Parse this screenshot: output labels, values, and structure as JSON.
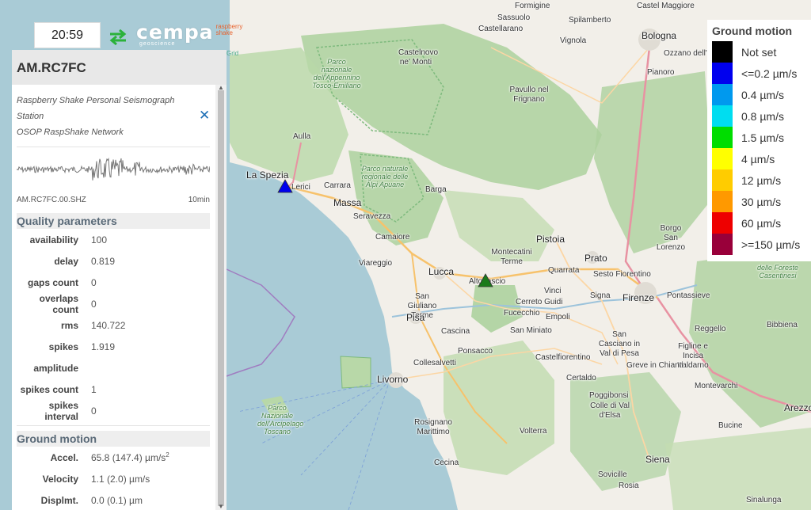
{
  "topbar": {
    "clock": "20:59",
    "logo_main": "cempa",
    "logo_sub": "geoscience",
    "logo_tag_1": "raspberry",
    "logo_tag_2": "shake"
  },
  "panel": {
    "station_code": "AM.RC7FC",
    "description_1": "Raspberry Shake Personal Seismograph Station",
    "description_2": "OSOP RaspShake Network",
    "waveform_channel": "AM.RC7FC.00.SHZ",
    "waveform_span": "10min",
    "quality_title": "Quality parameters",
    "quality": [
      {
        "key": "availability",
        "value": "100"
      },
      {
        "key": "delay",
        "value": "0.819"
      },
      {
        "key": "gaps count",
        "value": "0"
      },
      {
        "key": "overlaps count",
        "value": "0"
      },
      {
        "key": "rms",
        "value": "140.722"
      },
      {
        "key": "spikes",
        "value": "1.919"
      },
      {
        "key": "amplitude",
        "value": ""
      },
      {
        "key": "spikes count",
        "value": "1"
      },
      {
        "key": "spikes interval",
        "value": "0"
      }
    ],
    "motion_title": "Ground motion",
    "motion": [
      {
        "key": "Accel.",
        "value": "65.8 (147.4) µm/s",
        "sup": "2"
      },
      {
        "key": "Velocity",
        "value": "1.1 (2.0) µm/s",
        "sup": ""
      },
      {
        "key": "Displmt.",
        "value": "0.0 (0.1) µm",
        "sup": ""
      }
    ]
  },
  "legend": {
    "title": "Ground motion",
    "items": [
      {
        "label": "Not set",
        "color": "#000000"
      },
      {
        "label": "<=0.2 µm/s",
        "color": "#0000ee"
      },
      {
        "label": "0.4 µm/s",
        "color": "#0099ee"
      },
      {
        "label": "0.8 µm/s",
        "color": "#00ddf0"
      },
      {
        "label": "1.5 µm/s",
        "color": "#00dd00"
      },
      {
        "label": "4 µm/s",
        "color": "#ffff00"
      },
      {
        "label": "12 µm/s",
        "color": "#ffcc00"
      },
      {
        "label": "30 µm/s",
        "color": "#ff9900"
      },
      {
        "label": "60 µm/s",
        "color": "#ee0000"
      },
      {
        "label": ">=150 µm/s",
        "color": "#99003a"
      }
    ]
  },
  "map": {
    "attribution": "Grid",
    "places": [
      {
        "id": "formigine",
        "name": "Formigine"
      },
      {
        "id": "sassuolo",
        "name": "Sassuolo"
      },
      {
        "id": "spilamberto",
        "name": "Spilamberto"
      },
      {
        "id": "castelmaggiore",
        "name": "Castel Maggiore"
      },
      {
        "id": "castellarano",
        "name": "Castellarano"
      },
      {
        "id": "vignola",
        "name": "Vignola"
      },
      {
        "id": "bologna",
        "name": "Bologna"
      },
      {
        "id": "ozzano",
        "name": "Ozzano dell'E"
      },
      {
        "id": "castelnovo",
        "name": "Castelnovo ne' Monti"
      },
      {
        "id": "pianoro",
        "name": "Pianoro"
      },
      {
        "id": "pavullo",
        "name": "Pavullo nel Frignano"
      },
      {
        "id": "aulla",
        "name": "Aulla"
      },
      {
        "id": "laspezia",
        "name": "La Spezia"
      },
      {
        "id": "lerici",
        "name": "Lerici"
      },
      {
        "id": "carrara",
        "name": "Carrara"
      },
      {
        "id": "massa",
        "name": "Massa"
      },
      {
        "id": "seravezza",
        "name": "Seravezza"
      },
      {
        "id": "barga",
        "name": "Barga"
      },
      {
        "id": "camaiore",
        "name": "Camaiore"
      },
      {
        "id": "viareggio",
        "name": "Viareggio"
      },
      {
        "id": "pistoia",
        "name": "Pistoia"
      },
      {
        "id": "borgosansenzo",
        "name": "Borgo San Lorenzo"
      },
      {
        "id": "prato",
        "name": "Prato"
      },
      {
        "id": "montecatini",
        "name": "Montecatini Terme"
      },
      {
        "id": "quarrata",
        "name": "Quarrata"
      },
      {
        "id": "sesto",
        "name": "Sesto Fiorentino"
      },
      {
        "id": "lucca",
        "name": "Lucca"
      },
      {
        "id": "altopascio",
        "name": "Altopascio"
      },
      {
        "id": "sangiuliano",
        "name": "San Giuliano Terme"
      },
      {
        "id": "vinci",
        "name": "Vinci"
      },
      {
        "id": "cerreto",
        "name": "Cerreto Guidi"
      },
      {
        "id": "firenze",
        "name": "Firenze"
      },
      {
        "id": "pontassieve",
        "name": "Pontassieve"
      },
      {
        "id": "signa",
        "name": "Signa"
      },
      {
        "id": "fucecchio",
        "name": "Fucecchio"
      },
      {
        "id": "empoli",
        "name": "Empoli"
      },
      {
        "id": "pisa",
        "name": "Pisa"
      },
      {
        "id": "cascina",
        "name": "Cascina"
      },
      {
        "id": "sanminiato",
        "name": "San Miniato"
      },
      {
        "id": "sancasciano",
        "name": "San Casciano in Val di Pesa"
      },
      {
        "id": "reggello",
        "name": "Reggello"
      },
      {
        "id": "ponsacco",
        "name": "Ponsacco"
      },
      {
        "id": "figline",
        "name": "Figline e Incisa Valdarno"
      },
      {
        "id": "collesalvetti",
        "name": "Collesalvetti"
      },
      {
        "id": "castelfiorentino",
        "name": "Castelfiorentino"
      },
      {
        "id": "greve",
        "name": "Greve in Chianti"
      },
      {
        "id": "livorno",
        "name": "Livorno"
      },
      {
        "id": "certaldo",
        "name": "Certaldo"
      },
      {
        "id": "montevarchi",
        "name": "Montevarchi"
      },
      {
        "id": "arezzo",
        "name": "Arezzo"
      },
      {
        "id": "poggibonsi",
        "name": "Poggibonsi"
      },
      {
        "id": "colle",
        "name": "Colle di Val d'Elsa"
      },
      {
        "id": "bucine",
        "name": "Bucine"
      },
      {
        "id": "rosignano",
        "name": "Rosignano Marittimo"
      },
      {
        "id": "volterra",
        "name": "Volterra"
      },
      {
        "id": "siena",
        "name": "Siena"
      },
      {
        "id": "cecina",
        "name": "Cecina"
      },
      {
        "id": "sovicille",
        "name": "Sovicille"
      },
      {
        "id": "rosia",
        "name": "Rosia"
      },
      {
        "id": "sinalunga",
        "name": "Sinalunga"
      },
      {
        "id": "bibbiena",
        "name": "Bibbiena"
      }
    ],
    "parks": [
      {
        "id": "park-appennino",
        "name": "Parco nazionale dell'Appennino Tosco-Emiliano"
      },
      {
        "id": "park-apuane",
        "name": "Parco naturale regionale delle Alpi Apuane"
      },
      {
        "id": "park-arcipelago",
        "name": "Parco Nazionale dell'Arcipelago Toscano"
      },
      {
        "id": "park-casentinesi",
        "name": "delle Foreste Casentinesi"
      }
    ],
    "stations": [
      {
        "id": "station-lerici",
        "color": "#0000ee"
      },
      {
        "id": "station-altopascio",
        "color": "#1a7a1a"
      }
    ]
  }
}
